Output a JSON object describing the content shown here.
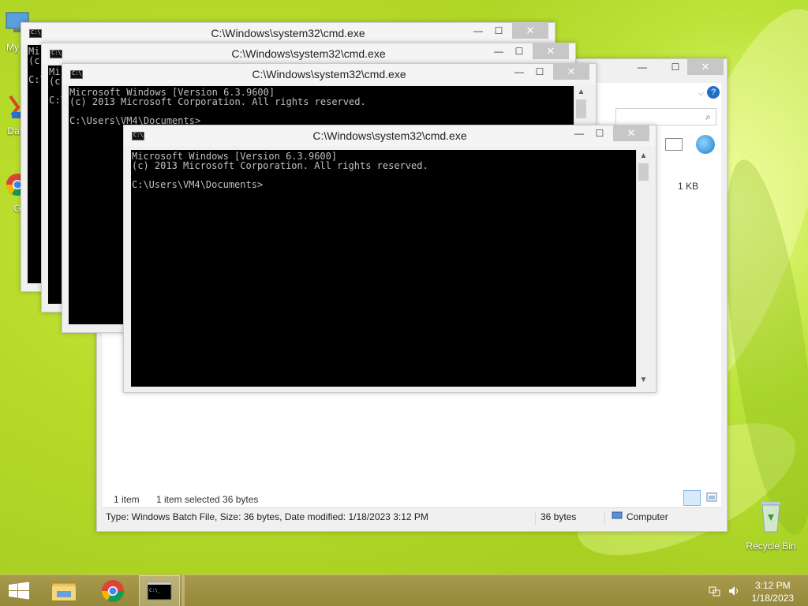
{
  "desktop": {
    "icons": [
      {
        "label": "My C"
      },
      {
        "label": "Data"
      },
      {
        "label": "G"
      },
      {
        "label": "Recycle Bin"
      }
    ]
  },
  "cmd_windows": [
    {
      "title": "C:\\Windows\\system32\\cmd.exe",
      "text": "Mi\n(c\n\nC:\\"
    },
    {
      "title": "C:\\Windows\\system32\\cmd.exe",
      "text": "Mi\n(c\n\nC:\\"
    },
    {
      "title": "C:\\Windows\\system32\\cmd.exe",
      "text": "Microsoft Windows [Version 6.3.9600]\n(c) 2013 Microsoft Corporation. All rights reserved.\n\nC:\\Users\\VM4\\Documents>"
    },
    {
      "title": "C:\\Windows\\system32\\cmd.exe",
      "text": "Microsoft Windows [Version 6.3.9600]\n(c) 2013 Microsoft Corporation. All rights reserved.\n\nC:\\Users\\VM4\\Documents>"
    }
  ],
  "window_controls": {
    "minimize": "—",
    "maximize": "☐",
    "close": "✕"
  },
  "explorer": {
    "file_size_cell": "1 KB",
    "item_count": "1 item",
    "selection": "1 item selected  36 bytes",
    "status": {
      "details": "Type: Windows Batch File, Size: 36 bytes, Date modified: 1/18/2023 3:12 PM",
      "size": "36 bytes",
      "location": "Computer"
    }
  },
  "taskbar": {
    "clock_time": "3:12 PM",
    "clock_date": "1/18/2023"
  },
  "colors": {
    "taskbar": "#9a8c3e",
    "console_bg": "#000000",
    "console_text": "#c0c0c0",
    "close_button": "#c7c7c7"
  }
}
